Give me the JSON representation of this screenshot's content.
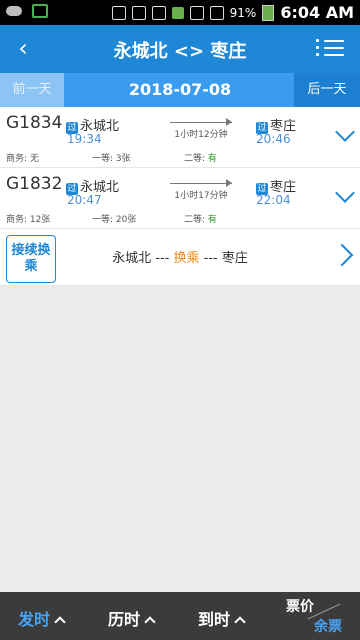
{
  "status": {
    "time": "6:04 AM",
    "battery": "91%"
  },
  "header": {
    "back_icon": "back-icon",
    "title": "永城北 <> 枣庄",
    "menu_icon": "menu-icon"
  },
  "datebar": {
    "prev": "前一天",
    "date": "2018-07-08",
    "next": "后一天"
  },
  "trains": [
    {
      "number": "G1834",
      "from": "永城北",
      "depart": "19:34",
      "duration": "1小时12分钟",
      "to": "枣庄",
      "arrive": "20:46",
      "business": "商务: 无",
      "first_label": "一等:",
      "first_value": "3张",
      "second_label": "二等:",
      "second_value": "有"
    },
    {
      "number": "G1832",
      "from": "永城北",
      "depart": "20:47",
      "duration": "1小时17分钟",
      "to": "枣庄",
      "arrive": "22:04",
      "business": "商务: 12张",
      "first_label": "一等:",
      "first_value": "20张",
      "second_label": "二等:",
      "second_value": "有"
    }
  ],
  "transfer": {
    "badge": "接续换乘",
    "from": "永城北",
    "mid": "换乘",
    "to": "枣庄"
  },
  "bottom": {
    "depart": "发时",
    "duration": "历时",
    "arrive": "到时",
    "price": "票价",
    "remaining": "余票"
  },
  "colors": {
    "primary": "#1e88d6",
    "datebar": "#3a9cf0",
    "accent_orange": "#f08c1a",
    "green": "#2e9b2e"
  }
}
